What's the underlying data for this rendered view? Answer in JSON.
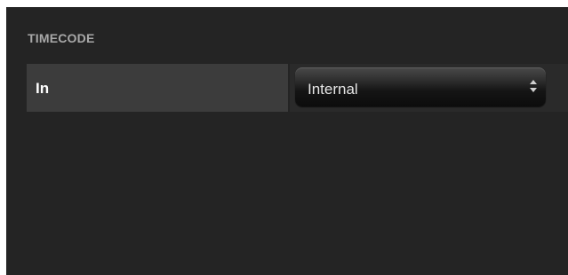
{
  "panel": {
    "section_title": "TIMECODE",
    "rows": [
      {
        "label": "In",
        "value": "Internal"
      }
    ]
  }
}
